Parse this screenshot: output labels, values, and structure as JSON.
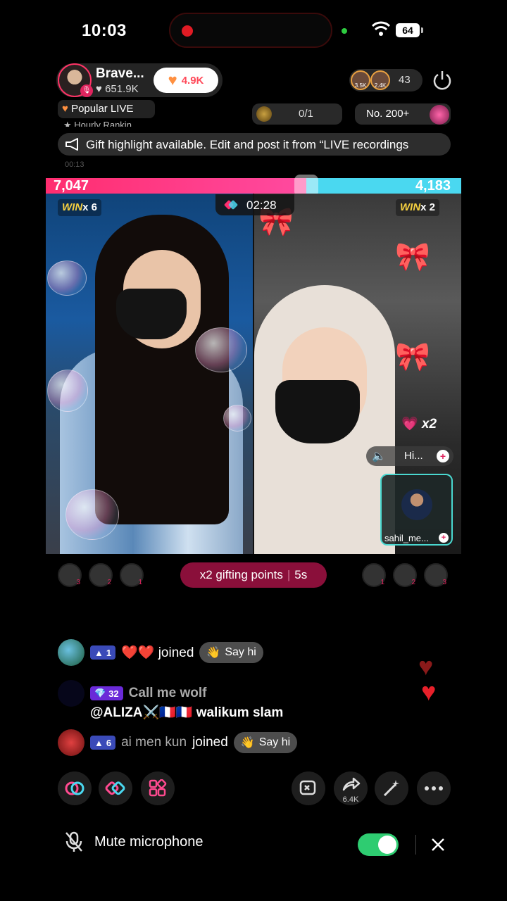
{
  "status_bar": {
    "time": "10:03",
    "battery": "64"
  },
  "host": {
    "name": "Brave...",
    "likes": "651.9K",
    "follow_count": "4.9K"
  },
  "viewers": {
    "count": "43",
    "top": [
      "3.5K",
      "2.4K"
    ]
  },
  "badges": {
    "popular": "Popular LIVE",
    "hourly": "Hourly Rankin",
    "gift_goal": "0/1",
    "rank": "No. 200+"
  },
  "banner": {
    "text": "Gift highlight available. Edit and post it from “LIVE recordings"
  },
  "faint_timestamp": "00:13",
  "battle": {
    "score_left": "7,047",
    "score_right": "4,183",
    "left_share": 0.627,
    "timer": "02:28",
    "win_left": {
      "label": "WIN",
      "mult": "x 6"
    },
    "win_right": {
      "label": "WIN",
      "mult": "x 2"
    },
    "multiplier": "x2",
    "guest_pill": "Hi...",
    "guest_name": "sahil_me...",
    "gifting_text": "x2 gifting points",
    "gifting_timer": "5s",
    "left_gifters": [
      "3",
      "2",
      "1"
    ],
    "right_gifters": [
      "1",
      "2",
      "3"
    ]
  },
  "chat": [
    {
      "level": "1",
      "text": "❤️❤️ joined",
      "say_hi": "Say hi"
    },
    {
      "level": "32",
      "name": "Call me wolf",
      "text": "@ALIZA⚔️🇫🇷🇫🇷 walikum slam"
    },
    {
      "level": "6",
      "name": "ai men kun",
      "text": "joined",
      "say_hi": "Say hi"
    }
  ],
  "toolbar": {
    "share_count": "6.4K"
  },
  "bottom": {
    "mute_label": "Mute microphone",
    "mute_on": true
  },
  "colors": {
    "accent": "#ff2d6f",
    "opponent": "#4ad8f0",
    "toggle": "#2ecc71"
  }
}
